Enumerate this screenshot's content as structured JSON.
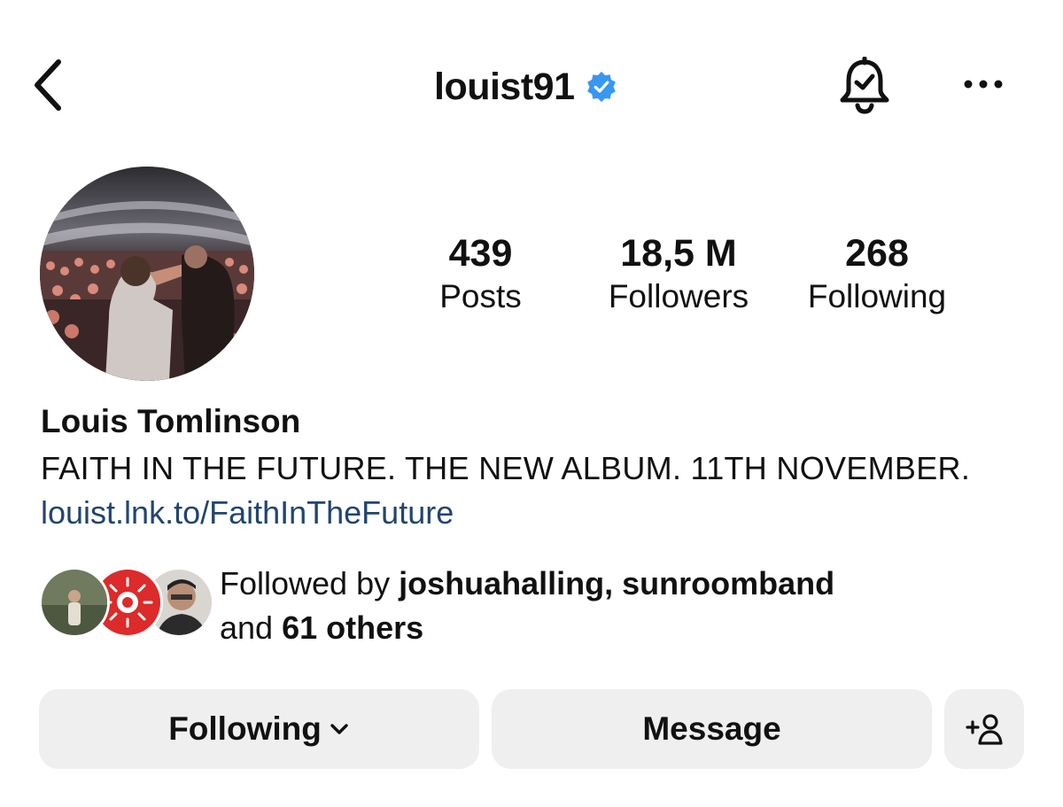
{
  "header": {
    "username": "louist91"
  },
  "stats": {
    "posts": {
      "count": "439",
      "label": "Posts"
    },
    "followers": {
      "count": "18,5 M",
      "label": "Followers"
    },
    "following": {
      "count": "268",
      "label": "Following"
    }
  },
  "profile": {
    "name": "Louis Tomlinson",
    "bio": "FAITH IN THE FUTURE. THE NEW ALBUM. 11TH NOVEMBER.",
    "link": "louist.lnk.to/FaithInTheFuture"
  },
  "mutual": {
    "prefix": "Followed by ",
    "user1": "joshuahalling",
    "separator": ", ",
    "user2": "sunroomband",
    "and": "and ",
    "others": "61 others"
  },
  "actions": {
    "following_label": "Following",
    "message_label": "Message"
  },
  "icons": {
    "back": "chevron-left-icon",
    "verified": "verified-badge-icon",
    "bell": "bell-check-icon",
    "more": "more-horizontal-icon",
    "dropdown": "chevron-down-icon",
    "add_user": "add-user-icon"
  },
  "colors": {
    "verified_blue": "#3897f0",
    "link": "#21456f",
    "button_bg": "#efefef"
  }
}
